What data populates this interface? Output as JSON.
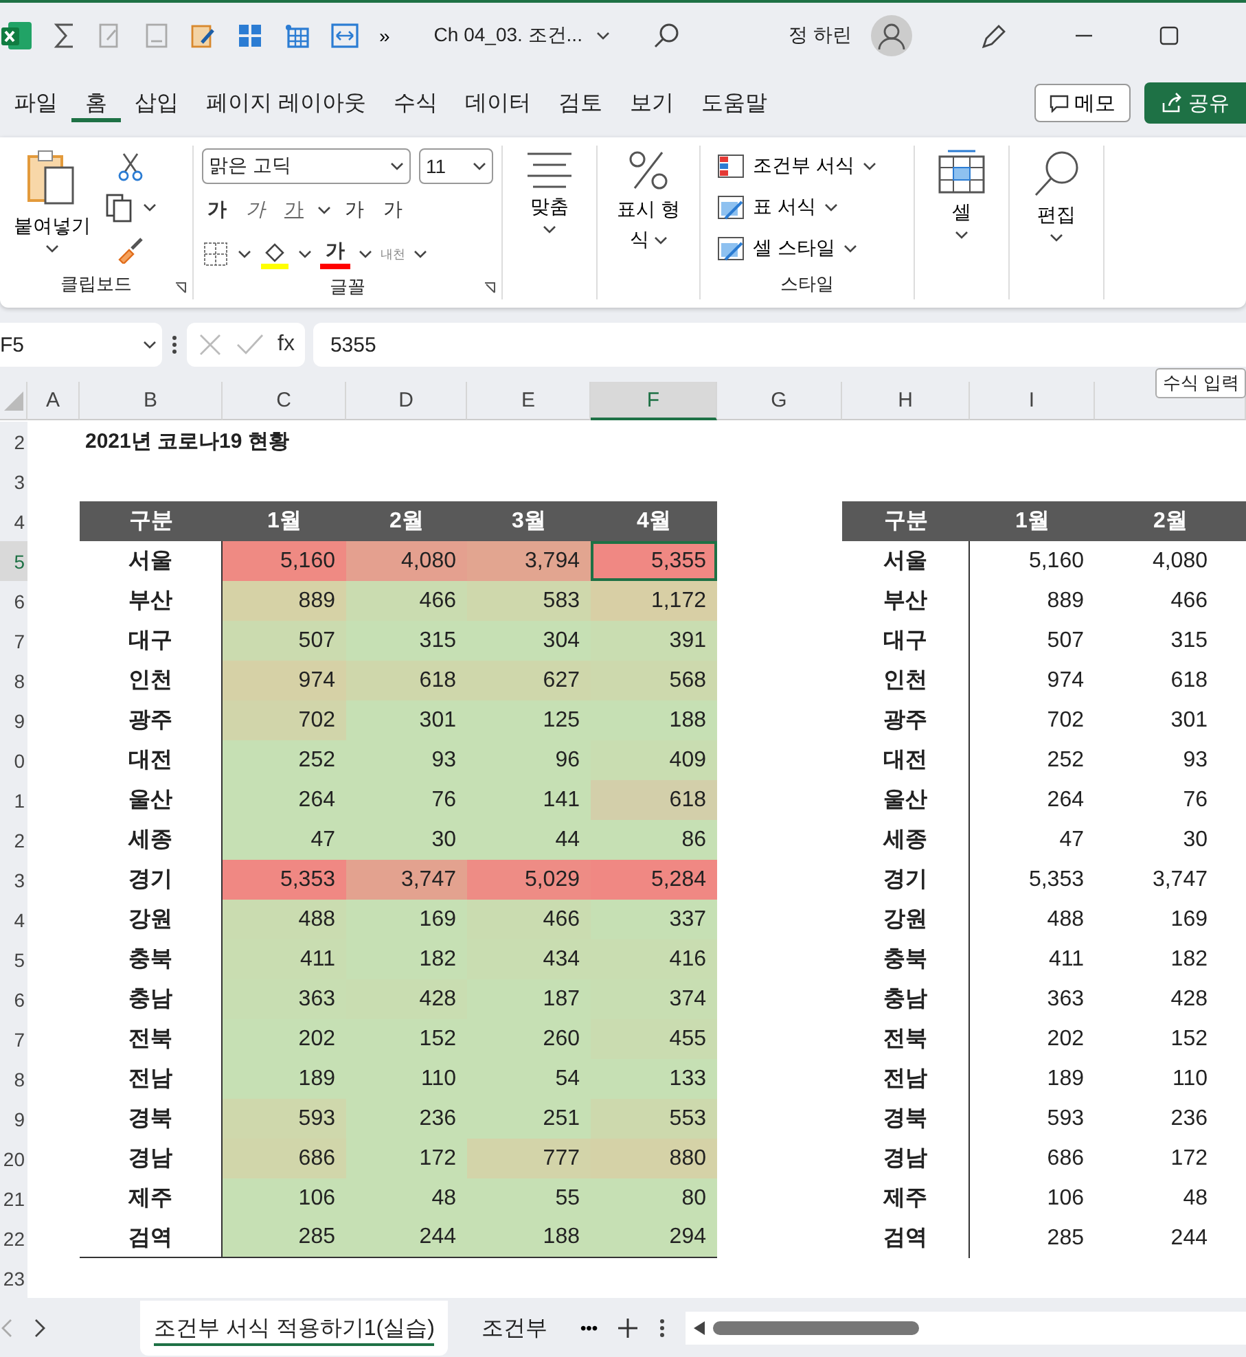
{
  "title_bar": {
    "more": "»",
    "document_title": "Ch 04_03. 조건...",
    "user_name": "정 하린"
  },
  "ribbon_tabs": [
    {
      "label": "파일",
      "selected": false
    },
    {
      "label": "홈",
      "selected": true
    },
    {
      "label": "삽입",
      "selected": false
    },
    {
      "label": "페이지 레이아웃",
      "selected": false
    },
    {
      "label": "수식",
      "selected": false
    },
    {
      "label": "데이터",
      "selected": false
    },
    {
      "label": "검토",
      "selected": false
    },
    {
      "label": "보기",
      "selected": false
    },
    {
      "label": "도움말",
      "selected": false
    }
  ],
  "memo_button": "메모",
  "share_button": "공유",
  "ribbon": {
    "paste": "붙여넣기",
    "clipboard_group": "클립보드",
    "font_name": "맑은 고딕",
    "font_size": "11",
    "bold": "가",
    "italic": "가",
    "underline": "가",
    "grow_font": "가",
    "shrink_font": "가",
    "font_color": "가",
    "phonetic": "내천",
    "font_group": "글꼴",
    "alignment": "맞춤",
    "number_format_top": "표시 형",
    "number_format_bottom": "식",
    "styles": [
      "조건부 서식",
      "표 서식",
      "셀 스타일"
    ],
    "styles_group": "스타일",
    "cells": "셀",
    "editing": "편집"
  },
  "formula_bar": {
    "name_box": "F5",
    "fx": "fx",
    "value": "5355",
    "tooltip": "수식 입력"
  },
  "columns": [
    {
      "label": "A",
      "selected": false
    },
    {
      "label": "B",
      "selected": false
    },
    {
      "label": "C",
      "selected": false
    },
    {
      "label": "D",
      "selected": false
    },
    {
      "label": "E",
      "selected": false
    },
    {
      "label": "F",
      "selected": true
    },
    {
      "label": "G",
      "selected": false
    },
    {
      "label": "H",
      "selected": false
    },
    {
      "label": "I",
      "selected": false
    }
  ],
  "row_numbers": [
    "2",
    "3",
    "4",
    "5",
    "6",
    "7",
    "8",
    "9",
    "0",
    "1",
    "2",
    "3",
    "4",
    "5",
    "6",
    "7",
    "8",
    "9",
    "20",
    "21",
    "22",
    "23"
  ],
  "sheet_title": "2021년 코로나19 현황",
  "table1": {
    "headers": [
      "구분",
      "1월",
      "2월",
      "3월",
      "4월"
    ],
    "rows": [
      {
        "region": "서울",
        "cells": [
          {
            "value": "5,160",
            "color": "#ef8a83"
          },
          {
            "value": "4,080",
            "color": "#e4a08f"
          },
          {
            "value": "3,794",
            "color": "#e2a590"
          },
          {
            "value": "5,355",
            "color": "#f08883"
          }
        ]
      },
      {
        "region": "부산",
        "cells": [
          {
            "value": "889",
            "color": "#d6d2a6"
          },
          {
            "value": "466",
            "color": "#cadcb0"
          },
          {
            "value": "583",
            "color": "#cfd8ac"
          },
          {
            "value": "1,172",
            "color": "#d8cfa5"
          }
        ]
      },
      {
        "region": "대구",
        "cells": [
          {
            "value": "507",
            "color": "#cbdbaf"
          },
          {
            "value": "315",
            "color": "#c6e0b4"
          },
          {
            "value": "304",
            "color": "#c6e0b4"
          },
          {
            "value": "391",
            "color": "#c9ddb1"
          }
        ]
      },
      {
        "region": "인천",
        "cells": [
          {
            "value": "974",
            "color": "#d6d1a6"
          },
          {
            "value": "618",
            "color": "#cfd7ab"
          },
          {
            "value": "627",
            "color": "#cfd7ab"
          },
          {
            "value": "568",
            "color": "#cdd9ad"
          }
        ]
      },
      {
        "region": "광주",
        "cells": [
          {
            "value": "702",
            "color": "#d1d5aa"
          },
          {
            "value": "301",
            "color": "#c6e0b4"
          },
          {
            "value": "125",
            "color": "#c6e0b4"
          },
          {
            "value": "188",
            "color": "#c6e0b4"
          }
        ]
      },
      {
        "region": "대전",
        "cells": [
          {
            "value": "252",
            "color": "#c6e0b4"
          },
          {
            "value": "93",
            "color": "#c6e0b4"
          },
          {
            "value": "96",
            "color": "#c6e0b4"
          },
          {
            "value": "409",
            "color": "#c9ddb1"
          }
        ]
      },
      {
        "region": "울산",
        "cells": [
          {
            "value": "264",
            "color": "#c6e0b4"
          },
          {
            "value": "76",
            "color": "#c6e0b4"
          },
          {
            "value": "141",
            "color": "#c6e0b4"
          },
          {
            "value": "618",
            "color": "#d3cfaa"
          }
        ]
      },
      {
        "region": "세종",
        "cells": [
          {
            "value": "47",
            "color": "#c6e0b4"
          },
          {
            "value": "30",
            "color": "#c6e0b4"
          },
          {
            "value": "44",
            "color": "#c6e0b4"
          },
          {
            "value": "86",
            "color": "#c6e0b4"
          }
        ]
      },
      {
        "region": "경기",
        "cells": [
          {
            "value": "5,353",
            "color": "#f08883"
          },
          {
            "value": "3,747",
            "color": "#e3a28f"
          },
          {
            "value": "5,029",
            "color": "#ee8c85"
          },
          {
            "value": "5,284",
            "color": "#f08883"
          }
        ]
      },
      {
        "region": "강원",
        "cells": [
          {
            "value": "488",
            "color": "#cadcb0"
          },
          {
            "value": "169",
            "color": "#c6e0b4"
          },
          {
            "value": "466",
            "color": "#cadcb0"
          },
          {
            "value": "337",
            "color": "#c6e0b4"
          }
        ]
      },
      {
        "region": "충북",
        "cells": [
          {
            "value": "411",
            "color": "#c9ddb1"
          },
          {
            "value": "182",
            "color": "#c6e0b4"
          },
          {
            "value": "434",
            "color": "#c9ddb1"
          },
          {
            "value": "416",
            "color": "#c9ddb1"
          }
        ]
      },
      {
        "region": "충남",
        "cells": [
          {
            "value": "363",
            "color": "#c8deb2"
          },
          {
            "value": "428",
            "color": "#c9ddb1"
          },
          {
            "value": "187",
            "color": "#c6e0b4"
          },
          {
            "value": "374",
            "color": "#c8deb2"
          }
        ]
      },
      {
        "region": "전북",
        "cells": [
          {
            "value": "202",
            "color": "#c6e0b4"
          },
          {
            "value": "152",
            "color": "#c6e0b4"
          },
          {
            "value": "260",
            "color": "#c6e0b4"
          },
          {
            "value": "455",
            "color": "#cadcb0"
          }
        ]
      },
      {
        "region": "전남",
        "cells": [
          {
            "value": "189",
            "color": "#c6e0b4"
          },
          {
            "value": "110",
            "color": "#c6e0b4"
          },
          {
            "value": "54",
            "color": "#c6e0b4"
          },
          {
            "value": "133",
            "color": "#c6e0b4"
          }
        ]
      },
      {
        "region": "경북",
        "cells": [
          {
            "value": "593",
            "color": "#cfd8ac"
          },
          {
            "value": "236",
            "color": "#c6e0b4"
          },
          {
            "value": "251",
            "color": "#c6e0b4"
          },
          {
            "value": "553",
            "color": "#cdd9ad"
          }
        ]
      },
      {
        "region": "경남",
        "cells": [
          {
            "value": "686",
            "color": "#d1d6aa"
          },
          {
            "value": "172",
            "color": "#c6e0b4"
          },
          {
            "value": "777",
            "color": "#d3d4a9"
          },
          {
            "value": "880",
            "color": "#d5d2a7"
          }
        ]
      },
      {
        "region": "제주",
        "cells": [
          {
            "value": "106",
            "color": "#c6e0b4"
          },
          {
            "value": "48",
            "color": "#c6e0b4"
          },
          {
            "value": "55",
            "color": "#c6e0b4"
          },
          {
            "value": "80",
            "color": "#c6e0b4"
          }
        ]
      },
      {
        "region": "검역",
        "cells": [
          {
            "value": "285",
            "color": "#c6e0b4"
          },
          {
            "value": "244",
            "color": "#c6e0b4"
          },
          {
            "value": "188",
            "color": "#c6e0b4"
          },
          {
            "value": "294",
            "color": "#c6e0b4"
          }
        ]
      }
    ]
  },
  "table2": {
    "headers": [
      "구분",
      "1월",
      "2월"
    ],
    "rows": [
      {
        "region": "서울",
        "values": [
          "5,160",
          "4,080"
        ]
      },
      {
        "region": "부산",
        "values": [
          "889",
          "466"
        ]
      },
      {
        "region": "대구",
        "values": [
          "507",
          "315"
        ]
      },
      {
        "region": "인천",
        "values": [
          "974",
          "618"
        ]
      },
      {
        "region": "광주",
        "values": [
          "702",
          "301"
        ]
      },
      {
        "region": "대전",
        "values": [
          "252",
          "93"
        ]
      },
      {
        "region": "울산",
        "values": [
          "264",
          "76"
        ]
      },
      {
        "region": "세종",
        "values": [
          "47",
          "30"
        ]
      },
      {
        "region": "경기",
        "values": [
          "5,353",
          "3,747"
        ]
      },
      {
        "region": "강원",
        "values": [
          "488",
          "169"
        ]
      },
      {
        "region": "충북",
        "values": [
          "411",
          "182"
        ]
      },
      {
        "region": "충남",
        "values": [
          "363",
          "428"
        ]
      },
      {
        "region": "전북",
        "values": [
          "202",
          "152"
        ]
      },
      {
        "region": "전남",
        "values": [
          "189",
          "110"
        ]
      },
      {
        "region": "경북",
        "values": [
          "593",
          "236"
        ]
      },
      {
        "region": "경남",
        "values": [
          "686",
          "172"
        ]
      },
      {
        "region": "제주",
        "values": [
          "106",
          "48"
        ]
      },
      {
        "region": "검역",
        "values": [
          "285",
          "244"
        ]
      }
    ]
  },
  "sheet_tabs": [
    {
      "label": "조건부 서식 적용하기1(실습)",
      "selected": true
    },
    {
      "label": "조건부",
      "selected": false
    }
  ],
  "sheet_tab_more": "•••"
}
